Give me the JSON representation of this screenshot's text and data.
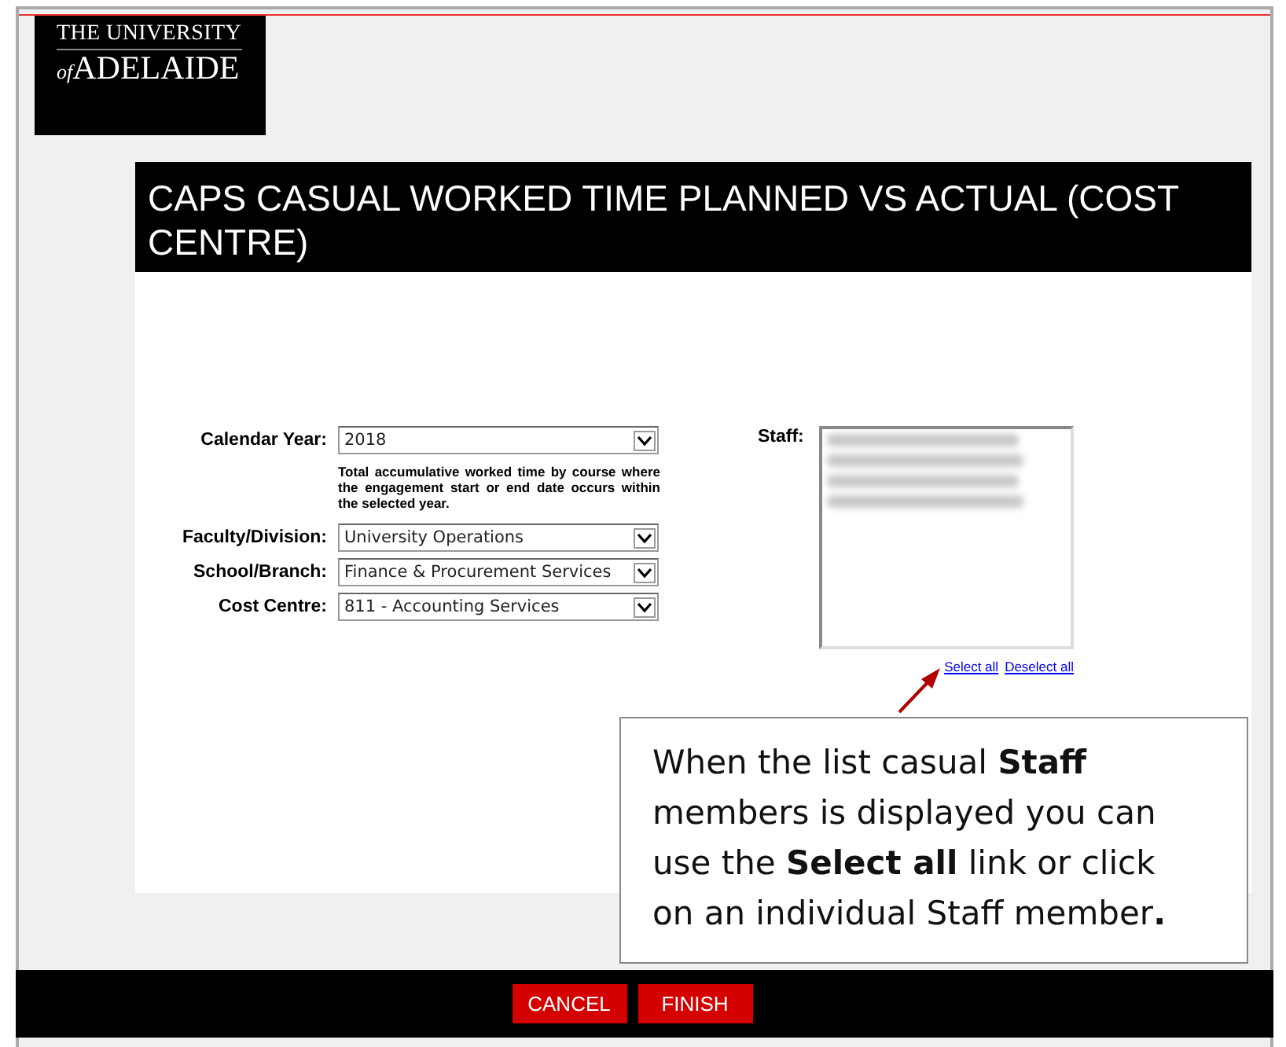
{
  "logo": {
    "line_1": "THE UNIVERSITY",
    "prefix": "of",
    "line_2": "ADELAIDE"
  },
  "title": "CAPS CASUAL WORKED TIME PLANNED VS ACTUAL (COST CENTRE)",
  "fields": [
    {
      "label": "Calendar Year:",
      "value": "2018",
      "note": "Total accumulative worked time by course where the engagement start or end date occurs within the selected year."
    },
    {
      "label": "Faculty/Division:",
      "value": "University Operations"
    },
    {
      "label": "School/Branch:",
      "value": "Finance & Procurement Services"
    },
    {
      "label": "Cost Centre:",
      "value": "811 - Accounting Services"
    }
  ],
  "staff": {
    "label": "Staff:",
    "entries": [
      {
        "kind": "redacted"
      },
      {
        "kind": "redacted"
      },
      {
        "kind": "redacted"
      },
      {
        "kind": "redacted"
      }
    ],
    "links": [
      "Select all",
      "Deselect all"
    ]
  },
  "callout": "When the list casual **Staff** members is displayed you can use the **Select all** link or click on an individual Staff member**.**",
  "buttons": [
    "CANCEL",
    "FINISH"
  ]
}
